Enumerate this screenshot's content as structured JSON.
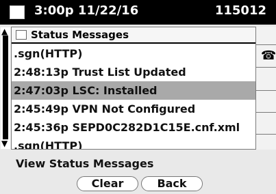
{
  "topbar": {
    "time_date": "3:00p 11/22/16",
    "extension": "115012",
    "icon": "messages-icon"
  },
  "panel": {
    "title": "Status Messages",
    "rows": [
      ".sgn(HTTP)",
      "2:48:13p Trust List Updated",
      "2:47:03p LSC: Installed",
      "2:45:49p VPN Not Configured",
      "2:45:36p SEPD0C282D1C15E.cnf.xml",
      ".sgn(HTTP)"
    ],
    "selected_index": 2
  },
  "side": {
    "line_icon": "phone-icon"
  },
  "status_text": "View Status Messages",
  "softkeys": {
    "clear": "Clear",
    "back": "Back"
  }
}
